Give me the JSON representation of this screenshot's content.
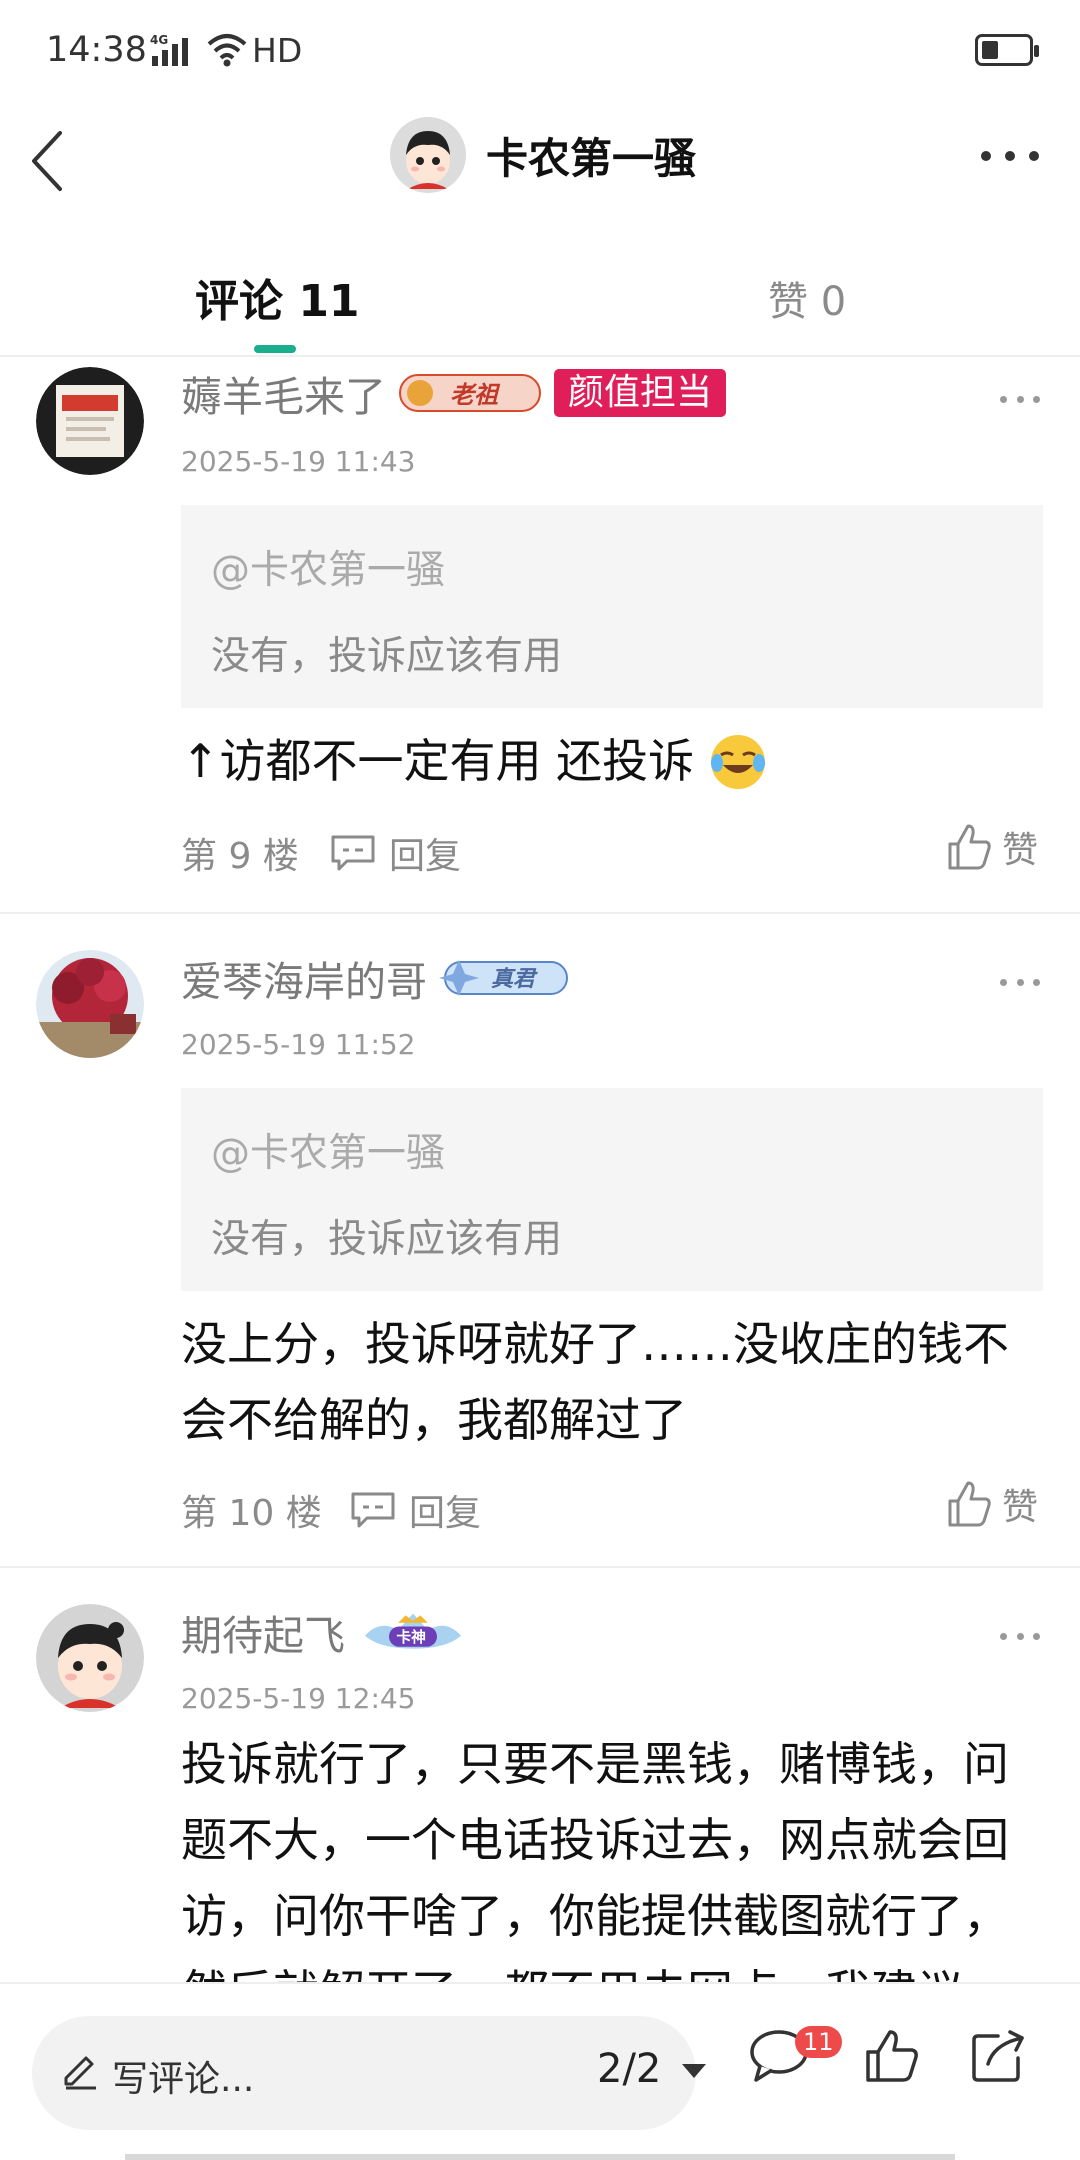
{
  "status_bar": {
    "time": "14:38",
    "network": "4G",
    "hd": "HD"
  },
  "header": {
    "title": "卡农第一骚"
  },
  "tabs": [
    {
      "label": "评论 11"
    },
    {
      "label": "赞 0"
    }
  ],
  "comments": [
    {
      "user": "薅羊毛来了",
      "badges": [
        "老祖"
      ],
      "tag": "颜值担当",
      "time": "2025-5-19 11:43",
      "quote_at": "@卡农第一骚",
      "quote_text": "没有，投诉应该有用",
      "text": "↑访都不一定有用 还投诉",
      "floor": "第 9 楼",
      "reply": "回复",
      "like": "赞"
    },
    {
      "user": "爱琴海岸的哥",
      "badges": [
        "真君"
      ],
      "time": "2025-5-19 11:52",
      "quote_at": "@卡农第一骚",
      "quote_text": "没有，投诉应该有用",
      "text": "没上分，投诉呀就好了……没收庄的钱不会不给解的，我都解过了",
      "floor": "第 10 楼",
      "reply": "回复",
      "like": "赞"
    },
    {
      "user": "期待起飞",
      "badges": [
        "卡神"
      ],
      "time": "2025-5-19 12:45",
      "text": "投诉就行了，只要不是黑钱，赌博钱，问题不大，一个电话投诉过去，网点就会回访，问你干啥了，你能提供截图就行了，然后就解开了，都不用去网点，我建议"
    }
  ],
  "bottom_bar": {
    "write_placeholder": "写评论...",
    "page": "2/2",
    "comment_count": "11"
  },
  "colors": {
    "accent": "#1aad8e",
    "tag_red": "#e01e5a",
    "badge_red": "#ee4a4a"
  }
}
